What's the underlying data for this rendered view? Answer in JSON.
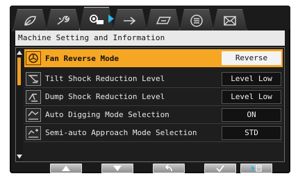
{
  "tabs": [
    {
      "icon": "leaf-icon"
    },
    {
      "icon": "wrench-icon"
    },
    {
      "icon": "machine-info-icon",
      "active": true
    },
    {
      "icon": "arrow-right-icon"
    },
    {
      "icon": "card-icon"
    },
    {
      "icon": "list-icon"
    },
    {
      "icon": "envelope-icon"
    }
  ],
  "title": "Machine Setting and Information",
  "rows": [
    {
      "label": "Fan Reverse Mode",
      "value": "Reverse",
      "icon": "fan-icon",
      "selected": true
    },
    {
      "label": "Tilt Shock Reduction Level",
      "value": "Level Low",
      "icon": "tilt-icon"
    },
    {
      "label": "Dump Shock Reduction Level",
      "value": "Level Low",
      "icon": "dump-icon"
    },
    {
      "label": "Auto Digging Mode Selection",
      "value": "ON",
      "icon": "auto-digging-icon"
    },
    {
      "label": "Semi-auto Approach Mode Selection",
      "value": "STD",
      "icon": "semi-auto-icon"
    }
  ],
  "buttons": [
    {
      "name": "up-button",
      "icon": "triangle-up-icon"
    },
    {
      "name": "down-button",
      "icon": "triangle-down-icon"
    },
    {
      "name": "back-button",
      "icon": "return-arrow-icon"
    },
    {
      "name": "confirm-button",
      "icon": "check-icon"
    },
    {
      "name": "next-page-button",
      "icon": "play-list-icon"
    }
  ],
  "colors": {
    "accent": "#f5a623",
    "tab_arrow": "#2fb5e8",
    "background": "#1a1a1a"
  },
  "scroll_position": 0
}
